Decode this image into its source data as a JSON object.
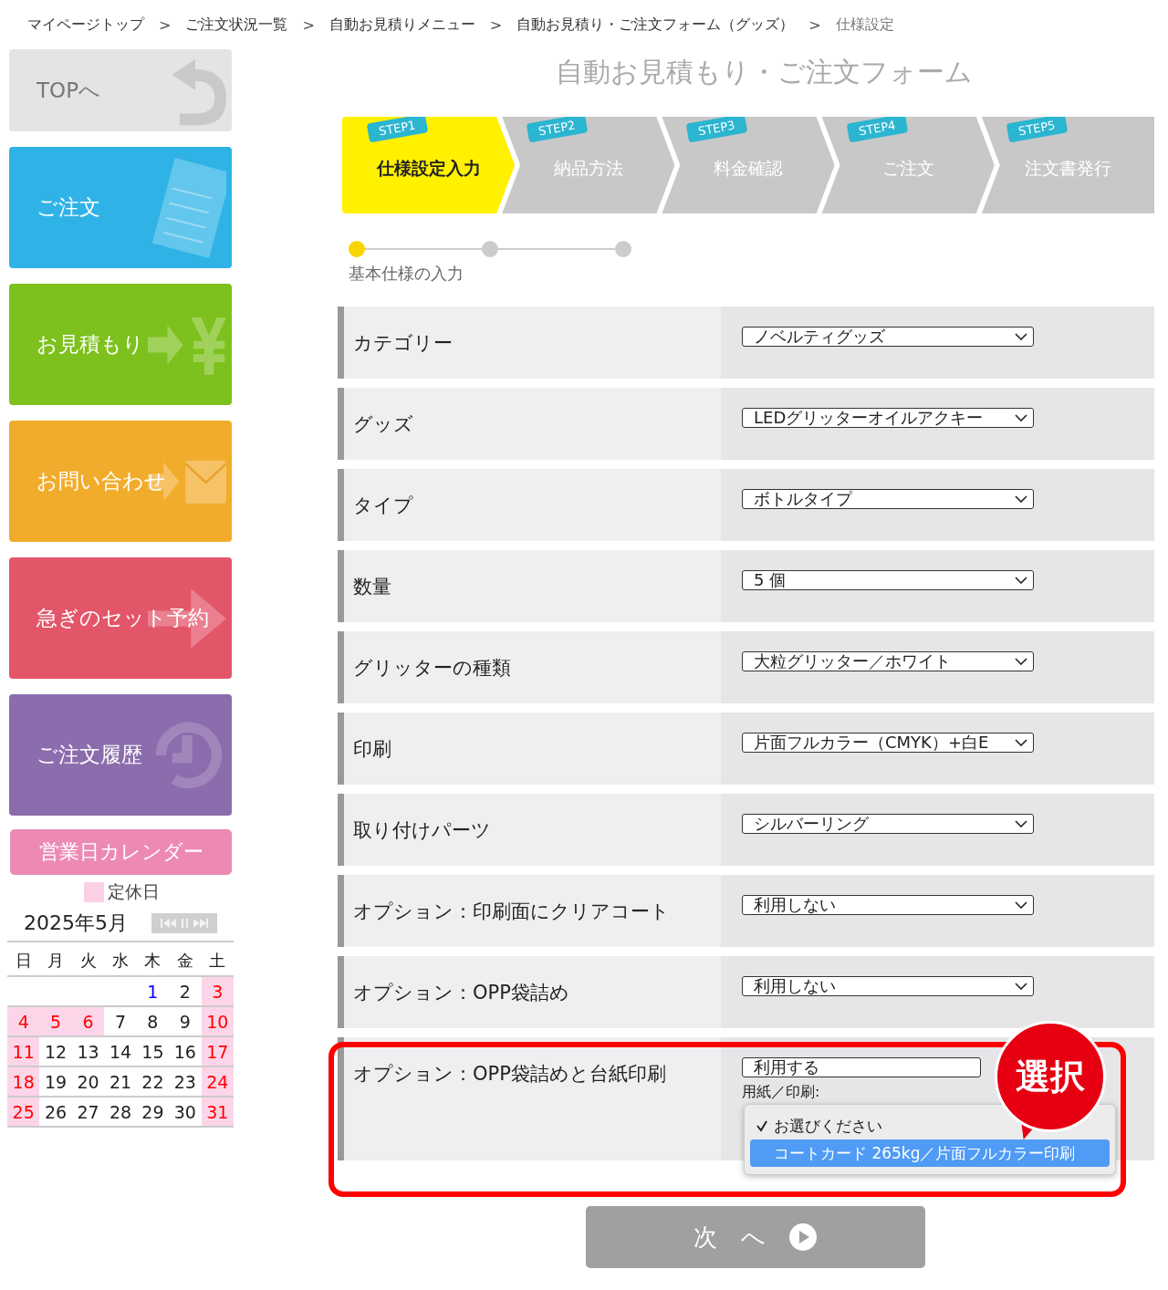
{
  "breadcrumb": {
    "separator": ">",
    "items": [
      "マイページトップ",
      "ご注文状況一覧",
      "自動お見積りメニュー",
      "自動お見積り・ご注文フォーム（グッズ）",
      "仕様設定"
    ]
  },
  "sidebar": {
    "items": [
      {
        "label": "TOPへ",
        "color": "#e4e4e4",
        "kind": "return"
      },
      {
        "label": "ご注文",
        "color": "#2fb3e6",
        "kind": "document"
      },
      {
        "label": "お見積もり",
        "color": "#7cc11d",
        "kind": "yen"
      },
      {
        "label": "お問い合わせ",
        "color": "#f2ac2b",
        "kind": "mail"
      },
      {
        "label": "急ぎのセット予約",
        "color": "#e3566a",
        "kind": "arrow"
      },
      {
        "label": "ご注文履歴",
        "color": "#8b6cad",
        "kind": "history"
      }
    ]
  },
  "calendar": {
    "title": "営業日カレンダー",
    "legend": "定休日",
    "month": "2025年5月",
    "weekdays": [
      "日",
      "月",
      "火",
      "水",
      "木",
      "金",
      "土"
    ],
    "weeks": [
      [
        {
          "day": "1",
          "holiday": false,
          "today": true
        },
        {
          "day": "2",
          "holiday": false,
          "today": false
        },
        {
          "day": "3",
          "holiday": true,
          "today": false
        }
      ],
      [
        {
          "day": "4",
          "holiday": true,
          "today": false
        },
        {
          "day": "5",
          "holiday": true,
          "today": false
        },
        {
          "day": "6",
          "holiday": true,
          "today": false
        },
        {
          "day": "7",
          "holiday": false,
          "today": false
        },
        {
          "day": "8",
          "holiday": false,
          "today": false
        },
        {
          "day": "9",
          "holiday": false,
          "today": false
        },
        {
          "day": "10",
          "holiday": true,
          "today": false
        }
      ],
      [
        {
          "day": "11",
          "holiday": true,
          "today": false
        },
        {
          "day": "12",
          "holiday": false,
          "today": false
        },
        {
          "day": "13",
          "holiday": false,
          "today": false
        },
        {
          "day": "14",
          "holiday": false,
          "today": false
        },
        {
          "day": "15",
          "holiday": false,
          "today": false
        },
        {
          "day": "16",
          "holiday": false,
          "today": false
        },
        {
          "day": "17",
          "holiday": true,
          "today": false
        }
      ],
      [
        {
          "day": "18",
          "holiday": true,
          "today": false
        },
        {
          "day": "19",
          "holiday": false,
          "today": false
        },
        {
          "day": "20",
          "holiday": false,
          "today": false
        },
        {
          "day": "21",
          "holiday": false,
          "today": false
        },
        {
          "day": "22",
          "holiday": false,
          "today": false
        },
        {
          "day": "23",
          "holiday": false,
          "today": false
        },
        {
          "day": "24",
          "holiday": true,
          "today": false
        }
      ],
      [
        {
          "day": "25",
          "holiday": true,
          "today": false
        },
        {
          "day": "26",
          "holiday": false,
          "today": false
        },
        {
          "day": "27",
          "holiday": false,
          "today": false
        },
        {
          "day": "28",
          "holiday": false,
          "today": false
        },
        {
          "day": "29",
          "holiday": false,
          "today": false
        },
        {
          "day": "30",
          "holiday": false,
          "today": false
        },
        {
          "day": "31",
          "holiday": true,
          "today": false
        }
      ]
    ]
  },
  "page_title": "自動お見積もり・ご注文フォーム",
  "steps": [
    {
      "badge": "STEP1",
      "label": "仕様設定入力",
      "selected": true
    },
    {
      "badge": "STEP2",
      "label": "納品方法",
      "selected": false
    },
    {
      "badge": "STEP3",
      "label": "料金確認",
      "selected": false
    },
    {
      "badge": "STEP4",
      "label": "ご注文",
      "selected": false
    },
    {
      "badge": "STEP5",
      "label": "注文書発行",
      "selected": false
    }
  ],
  "progress": {
    "dots": [
      {
        "selected": true
      },
      {
        "selected": false
      },
      {
        "selected": false
      }
    ],
    "label": "基本仕様の入力"
  },
  "form_rows": [
    {
      "label": "カテゴリー",
      "value": "ノベルティグッズ"
    },
    {
      "label": "グッズ",
      "value": "LEDグリッターオイルアクキー"
    },
    {
      "label": "タイプ",
      "value": "ボトルタイプ"
    },
    {
      "label": "数量",
      "value": "5 個"
    },
    {
      "label": "グリッターの種類",
      "value": "大粒グリッター／ホワイト"
    },
    {
      "label": "印刷",
      "value": "片面フルカラー（CMYK）+白E"
    },
    {
      "label": "取り付けパーツ",
      "value": "シルバーリング"
    },
    {
      "label": "オプション：印刷面にクリアコート",
      "value": "利用しない"
    },
    {
      "label": "オプション：OPP袋詰め",
      "value": "利用しない"
    }
  ],
  "highlight_row": {
    "label": "オプション：OPP袋詰めと台紙印刷",
    "value": "利用する",
    "sub_label": "用紙／印刷:",
    "options": [
      {
        "label": "お選びください",
        "checked": true,
        "selected": false
      },
      {
        "label": "コートカード 265kg／片面フルカラー印刷",
        "checked": false,
        "selected": true
      }
    ],
    "callout": "選択"
  },
  "next_button": "次 へ"
}
